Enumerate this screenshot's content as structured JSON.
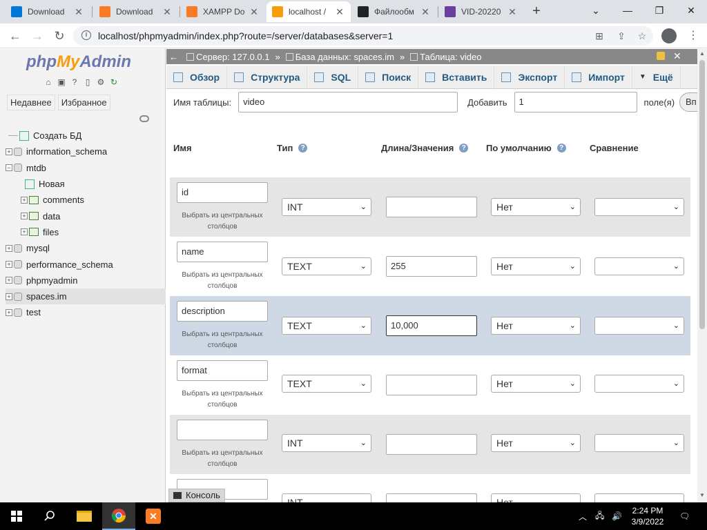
{
  "browser": {
    "tabs": [
      {
        "title": "Download",
        "favicon_color": "#0078d7"
      },
      {
        "title": "Download",
        "favicon_color": "#fb7a24"
      },
      {
        "title": "XAMPP Do",
        "favicon_color": "#fb7a24"
      },
      {
        "title": "localhost /",
        "favicon_color": "#f89c0e"
      },
      {
        "title": "Файлообм",
        "favicon_color": "#222222"
      },
      {
        "title": "VID-20220",
        "favicon_color": "#6b3fa0"
      }
    ],
    "new_tab": "+",
    "url": "localhost/phpmyadmin/index.php?route=/server/databases&server=1"
  },
  "sidebar": {
    "logo": {
      "php": "php",
      "my": "My",
      "admin": "Admin"
    },
    "tabs": [
      "Недавнее",
      "Избранное"
    ],
    "tree": [
      {
        "label": "Создать БД",
        "kind": "new",
        "level": 0
      },
      {
        "label": "information_schema",
        "kind": "db",
        "level": 0
      },
      {
        "label": "mtdb",
        "kind": "db",
        "level": 0,
        "expanded": true
      },
      {
        "label": "Новая",
        "kind": "new",
        "level": 1
      },
      {
        "label": "comments",
        "kind": "table",
        "level": 1
      },
      {
        "label": "data",
        "kind": "table",
        "level": 1
      },
      {
        "label": "files",
        "kind": "table",
        "level": 1
      },
      {
        "label": "mysql",
        "kind": "db",
        "level": 0
      },
      {
        "label": "performance_schema",
        "kind": "db",
        "level": 0
      },
      {
        "label": "phpmyadmin",
        "kind": "db",
        "level": 0
      },
      {
        "label": "spaces.im",
        "kind": "db",
        "level": 0,
        "selected": true
      },
      {
        "label": "test",
        "kind": "db",
        "level": 0
      }
    ]
  },
  "breadcrumb": {
    "server": "Сервер: 127.0.0.1",
    "database": "База данных: spaces.im",
    "table": "Таблица: video"
  },
  "menu": [
    "Обзор",
    "Структура",
    "SQL",
    "Поиск",
    "Вставить",
    "Экспорт",
    "Импорт",
    "Ещё"
  ],
  "form": {
    "table_name_label": "Имя таблицы:",
    "table_name_value": "video",
    "add_label": "Добавить",
    "add_value": "1",
    "fields_label": "поле(я)",
    "go_button": "Вп"
  },
  "columns": [
    "Имя",
    "Тип",
    "Длина/Значения",
    "По умолчанию",
    "Сравнение"
  ],
  "central_columns_text": "Выбрать из центральных столбцов",
  "fields": [
    {
      "name": "id",
      "type": "INT",
      "length": "",
      "default": "Нет",
      "collation": ""
    },
    {
      "name": "name",
      "type": "TEXT",
      "length": "255",
      "default": "Нет",
      "collation": ""
    },
    {
      "name": "description",
      "type": "TEXT",
      "length": "10,000",
      "default": "Нет",
      "collation": "",
      "focused": true
    },
    {
      "name": "format",
      "type": "TEXT",
      "length": "",
      "default": "Нет",
      "collation": ""
    },
    {
      "name": "",
      "type": "INT",
      "length": "",
      "default": "Нет",
      "collation": ""
    },
    {
      "name": "",
      "type": "INT",
      "length": "",
      "default": "Нет",
      "collation": ""
    }
  ],
  "console_label": "Консоль",
  "taskbar": {
    "time": "2:24 PM",
    "date": "3/9/2022"
  }
}
